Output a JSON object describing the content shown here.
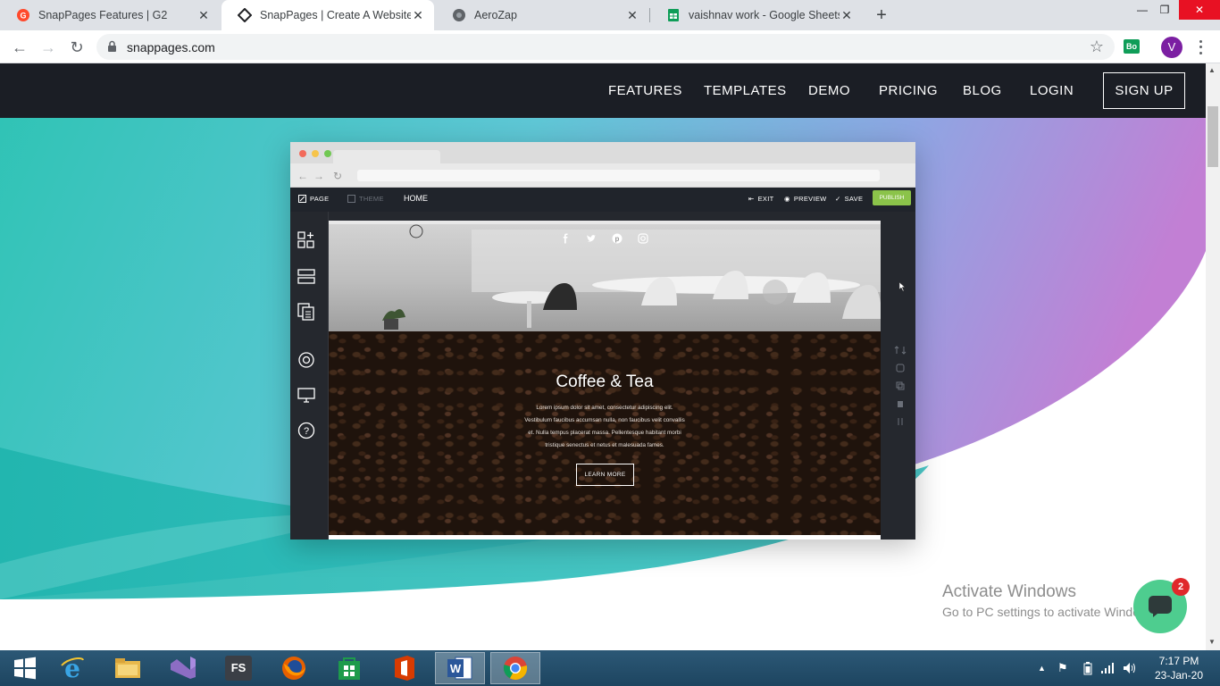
{
  "browser": {
    "tabs": [
      {
        "title": "SnapPages Features | G2",
        "active": false,
        "favicon": "g2-logo-icon"
      },
      {
        "title": "SnapPages | Create A Website",
        "active": true,
        "favicon": "snappages-logo-icon"
      },
      {
        "title": "AeroZap",
        "active": false,
        "favicon": "globe-icon"
      },
      {
        "title": "vaishnav work - Google Sheets",
        "active": false,
        "favicon": "sheets-icon"
      }
    ],
    "new_tab": "+",
    "url": "snappages.com",
    "profile_initial": "V",
    "extension_label": "Bo"
  },
  "site_nav": {
    "features": "FEATURES",
    "templates": "TEMPLATES",
    "demo": "DEMO",
    "pricing": "PRICING",
    "blog": "BLOG",
    "login": "LOGIN",
    "signup": "SIGN UP"
  },
  "editor": {
    "page": "PAGE",
    "theme": "THEME",
    "home": "HOME",
    "exit": "EXIT",
    "preview": "PREVIEW",
    "save": "SAVE",
    "publish": "PUBLISH",
    "section_title": "Coffee & Tea",
    "body_lines": [
      "Lorem ipsum dolor sit amet, consectetur adipiscing elit.",
      "Vestibulum faucibus accumsan nulla, non faucibus velit convallis",
      "et. Nulla tempus placerat massa. Pellentesque habitant morbi",
      "tristique senectus et netus et malesuada fames."
    ],
    "cta": "LEARN MORE"
  },
  "watermark": {
    "line1": "Activate Windows",
    "line2": "Go to PC settings to activate Windows."
  },
  "chat": {
    "badge_count": "2"
  },
  "taskbar": {
    "apps": [
      "windows-start-icon",
      "internet-explorer-icon",
      "file-explorer-icon",
      "visual-studio-icon",
      "fs-app-icon",
      "firefox-icon",
      "store-icon",
      "office-icon",
      "word-icon",
      "chrome-icon"
    ],
    "fs_label": "FS",
    "time": "7:17 PM",
    "date": "23-Jan-20"
  },
  "colors": {
    "nav_bg": "#1b1e25",
    "teal": "#2ec3b4",
    "purple": "#b37fd8",
    "publish_green": "#8bc34a",
    "chat_green": "#4ecd8f"
  }
}
